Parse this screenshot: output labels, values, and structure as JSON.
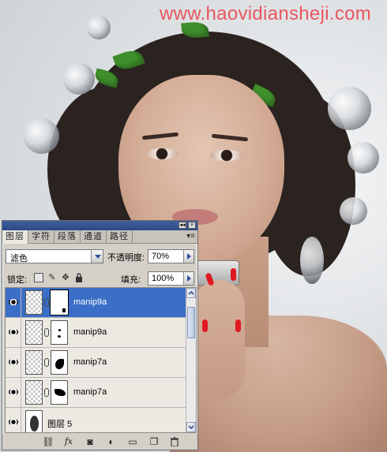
{
  "watermark": "www.haovidiansheji.com",
  "panel": {
    "tabs": [
      "图层",
      "字符",
      "段落",
      "通道",
      "路径"
    ],
    "active_tab": 0,
    "blend_mode": "滤色",
    "opacity_label": "不透明度:",
    "opacity_value": "70%",
    "lock_label": "锁定:",
    "fill_label": "填充:",
    "fill_value": "100%",
    "layers": [
      {
        "name": "manip9a",
        "selected": true,
        "has_mask": true,
        "mask_shape": "corner"
      },
      {
        "name": "manip9a",
        "selected": false,
        "has_mask": true,
        "mask_shape": "dots"
      },
      {
        "name": "manip7a",
        "selected": false,
        "has_mask": true,
        "mask_shape": "leaf"
      },
      {
        "name": "manip7a",
        "selected": false,
        "has_mask": true,
        "mask_shape": "wing"
      },
      {
        "name": "图层 5",
        "selected": false,
        "has_mask": false,
        "mask_shape": ""
      }
    ],
    "footer_icons": [
      "link-layers-icon",
      "fx-icon",
      "add-mask-icon",
      "adjustment-layer-icon",
      "new-group-icon",
      "new-layer-icon",
      "trash-icon"
    ],
    "footer_glyphs": {
      "link": "⛓",
      "fx": "fx",
      "mask": "◙",
      "adjust": "◐",
      "group": "▭",
      "new": "❐",
      "trash": "🗑"
    }
  },
  "colors": {
    "selection": "#3b6fc7",
    "panel_bg": "#d4d0c8",
    "watermark": "#e8575f",
    "titlebar": "#2d4a86"
  }
}
